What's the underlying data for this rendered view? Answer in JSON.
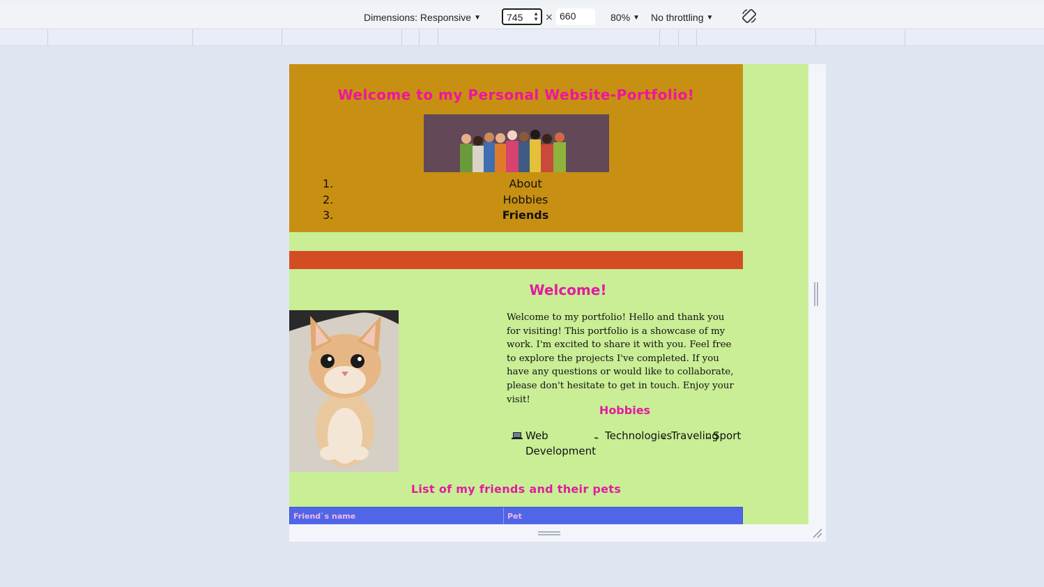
{
  "devtools": {
    "dimensions_label": "Dimensions: Responsive",
    "width_value": "745",
    "times": "×",
    "height_value": "660",
    "zoom": "80%",
    "throttling": "No throttling",
    "icons": [
      "caret-down-icon",
      "spinner-icon",
      "rotate-icon",
      "resize-handle-icon"
    ]
  },
  "site": {
    "title": "Welcome to my Personal Website-Portfolio!",
    "nav": [
      {
        "num": "1.",
        "label": "About"
      },
      {
        "num": "2.",
        "label": "Hobbies"
      },
      {
        "num": "3.",
        "label": "Friends"
      }
    ],
    "welcome_heading": "Welcome!",
    "intro_text": "Welcome to my portfolio! Hello and thank you for visiting! This portfolio is a showcase of my work. I'm excited to share it with you. Feel free to explore the projects I've completed. If you have any questions or would like to collaborate, please don't hesitate to get in touch. Enjoy your visit!",
    "hobbies_heading": "Hobbies",
    "hobbies": [
      {
        "icon": "laptop-icon",
        "label_line1": "Web",
        "label_line2": "Development"
      },
      {
        "icon": "broken-image-icon",
        "label": "Technologies"
      },
      {
        "icon": "broken-image-icon",
        "label": "Traveling"
      },
      {
        "icon": "broken-image-icon",
        "label": "Sport"
      }
    ],
    "friends_heading": "List of my friends and their pets",
    "table_headers": [
      "Friend`s name",
      "Pet"
    ],
    "colors": {
      "header_bg": "#c79013",
      "page_bg": "#c9ee96",
      "accent_pink": "#e21ba0",
      "red_bar": "#d44c22",
      "table_header": "#5066e8"
    }
  }
}
